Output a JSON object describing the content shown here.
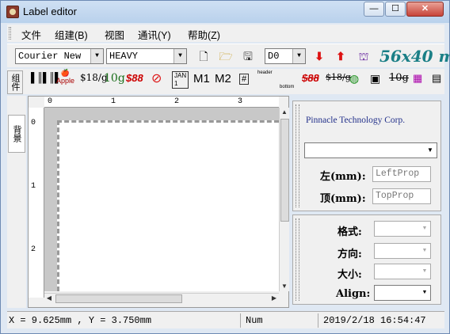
{
  "window": {
    "title": "Label editor",
    "min_glyph": "—",
    "max_glyph": "☐",
    "close_glyph": "✕"
  },
  "menu": [
    {
      "label": "文件"
    },
    {
      "label": "组建(B)"
    },
    {
      "label": "视图"
    },
    {
      "label": "通讯(Y)"
    },
    {
      "label": "帮助(Z)"
    }
  ],
  "toolbar": {
    "font_select": "Courier New",
    "weight_select": "HEAVY",
    "direction_select": "D0",
    "label_size": "56x40 m"
  },
  "toolbar2": {
    "side_tab": "组件",
    "apple_text": "Apple",
    "price1": "$18/g",
    "price2": "10g",
    "price3": "$88",
    "jan_text": "JAN",
    "m1": "M1",
    "m2": "M2",
    "hash": "#",
    "header_text": "header",
    "bottom_text": "bottom",
    "price4": "$88",
    "price5": "$18/g",
    "price6": "10g"
  },
  "sidebar": {
    "tab_label": "背景"
  },
  "ruler": {
    "h_marks": [
      "0",
      "1",
      "2",
      "3"
    ],
    "v_marks": [
      "0",
      "1",
      "2"
    ]
  },
  "props": {
    "company": "Pinnacle Technology Corp.",
    "left_label": "左(mm):",
    "left_placeholder": "LeftProp",
    "top_label": "顶(mm):",
    "top_placeholder": "TopProp",
    "format_label": "格式:",
    "direction_label": "方向:",
    "size_label": "大小:",
    "align_label": "Align:"
  },
  "status": {
    "coords": "X =   9.625mm , Y =   3.750mm",
    "numlock": "Num",
    "datetime": "2019/2/18 16:54:47"
  },
  "colors": {
    "accent": "#1a7f86",
    "title_bg": "#c6d9f0",
    "company": "#22308a"
  }
}
